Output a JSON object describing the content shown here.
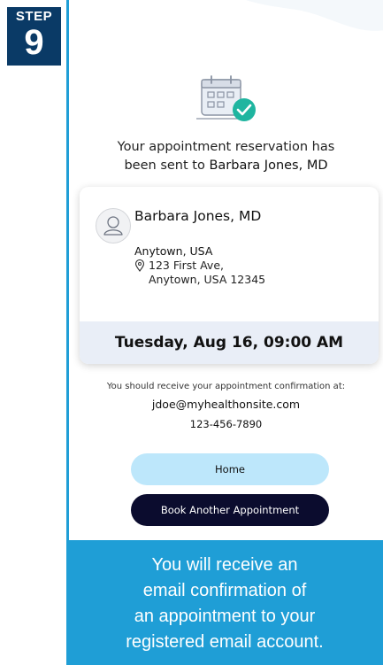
{
  "step": {
    "label": "STEP",
    "number": "9"
  },
  "headline": {
    "line1": "Your appointment reservation has",
    "line2_prefix": "been sent to ",
    "line2_doctor": "Barbara Jones, MD"
  },
  "card": {
    "doctor_name": "Barbara Jones, MD",
    "city": "Anytown, USA",
    "address_line1": "123 First Ave,",
    "address_line2": "Anytown, USA 12345",
    "datetime": "Tuesday, Aug 16, 09:00 AM"
  },
  "confirmation": {
    "note": "You should receive your appointment confirmation at:",
    "email": "jdoe@myhealthonsite.com",
    "phone": "123-456-7890"
  },
  "buttons": {
    "home": "Home",
    "book_another": "Book Another Appointment"
  },
  "caption": {
    "line1": "You will receive an",
    "line2": "email confirmation of",
    "line3": "an appointment to your",
    "line4": "registered email account."
  },
  "colors": {
    "step_badge": "#0a3a66",
    "accent_blue": "#1f9ed6",
    "home_button": "#bde7fb",
    "book_button": "#0b0c2e",
    "date_band": "#e9eef7",
    "check_green": "#1fb5a0"
  },
  "icons": {
    "calendar": "calendar-check-icon",
    "avatar": "user-avatar-icon",
    "pin": "location-pin-icon"
  }
}
